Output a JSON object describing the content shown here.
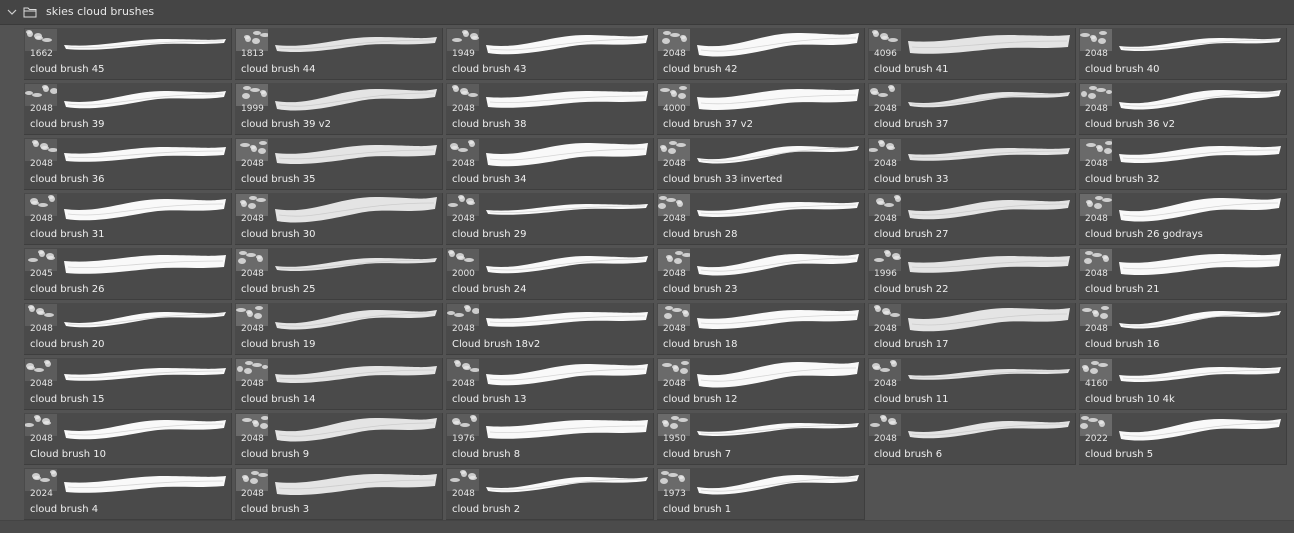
{
  "group": {
    "name": "skies cloud brushes",
    "expand_icon": "chevron-down-icon",
    "folder_icon": "folder-icon"
  },
  "colors": {
    "panel_bg": "#535353",
    "tile_bg": "#4a4a4a",
    "text": "#f0f0f0",
    "stroke": "#ffffff"
  },
  "columns": 6,
  "brushes": [
    {
      "name": "cloud brush 45",
      "size": "1662"
    },
    {
      "name": "cloud brush 44",
      "size": "1813"
    },
    {
      "name": "cloud brush 43",
      "size": "1949"
    },
    {
      "name": "cloud brush 42",
      "size": "2048"
    },
    {
      "name": "cloud brush 41",
      "size": "4096"
    },
    {
      "name": "cloud brush 40",
      "size": "2048"
    },
    {
      "name": "cloud brush 39",
      "size": "2048"
    },
    {
      "name": "cloud brush 39 v2",
      "size": "1999"
    },
    {
      "name": "cloud brush 38",
      "size": "2048"
    },
    {
      "name": "cloud brush 37 v2",
      "size": "4000"
    },
    {
      "name": "cloud brush 37",
      "size": "2048"
    },
    {
      "name": "cloud brush 36 v2",
      "size": "2048"
    },
    {
      "name": "cloud brush 36",
      "size": "2048"
    },
    {
      "name": "cloud brush 35",
      "size": "2048"
    },
    {
      "name": "cloud brush 34",
      "size": "2048"
    },
    {
      "name": "cloud brush 33 inverted",
      "size": "2048"
    },
    {
      "name": "cloud brush 33",
      "size": "2048"
    },
    {
      "name": "cloud brush 32",
      "size": "2048"
    },
    {
      "name": "cloud brush 31",
      "size": "2048"
    },
    {
      "name": "cloud brush 30",
      "size": "2048"
    },
    {
      "name": "cloud brush 29",
      "size": "2048"
    },
    {
      "name": "cloud brush 28",
      "size": "2048"
    },
    {
      "name": "cloud brush 27",
      "size": "2048"
    },
    {
      "name": "cloud brush 26 godrays",
      "size": "2048"
    },
    {
      "name": "cloud brush 26",
      "size": "2045"
    },
    {
      "name": "cloud brush 25",
      "size": "2048"
    },
    {
      "name": "cloud brush 24",
      "size": "2000"
    },
    {
      "name": "cloud brush 23",
      "size": "2048"
    },
    {
      "name": "cloud brush 22",
      "size": "1996"
    },
    {
      "name": "cloud brush 21",
      "size": "2048"
    },
    {
      "name": "cloud brush 20",
      "size": "2048"
    },
    {
      "name": "cloud brush 19",
      "size": "2048"
    },
    {
      "name": "Cloud brush 18v2",
      "size": "2048"
    },
    {
      "name": "cloud brush 18",
      "size": "2048"
    },
    {
      "name": "cloud brush 17",
      "size": "2048"
    },
    {
      "name": "cloud brush 16",
      "size": "2048"
    },
    {
      "name": "cloud brush 15",
      "size": "2048"
    },
    {
      "name": "cloud brush 14",
      "size": "2048"
    },
    {
      "name": "cloud brush 13",
      "size": "2048"
    },
    {
      "name": "cloud brush 12",
      "size": "2048"
    },
    {
      "name": "cloud brush 11",
      "size": "2048"
    },
    {
      "name": "cloud brush 10 4k",
      "size": "4160"
    },
    {
      "name": "Cloud brush 10",
      "size": "2048"
    },
    {
      "name": "cloud brush 9",
      "size": "2048"
    },
    {
      "name": "cloud brush 8",
      "size": "1976"
    },
    {
      "name": "cloud brush 7",
      "size": "1950"
    },
    {
      "name": "cloud brush 6",
      "size": "2048"
    },
    {
      "name": "cloud brush 5",
      "size": "2022"
    },
    {
      "name": "cloud brush 4",
      "size": "2024"
    },
    {
      "name": "cloud brush 3",
      "size": "2048"
    },
    {
      "name": "cloud brush 2",
      "size": "2048"
    },
    {
      "name": "cloud brush 1",
      "size": "1973"
    }
  ]
}
